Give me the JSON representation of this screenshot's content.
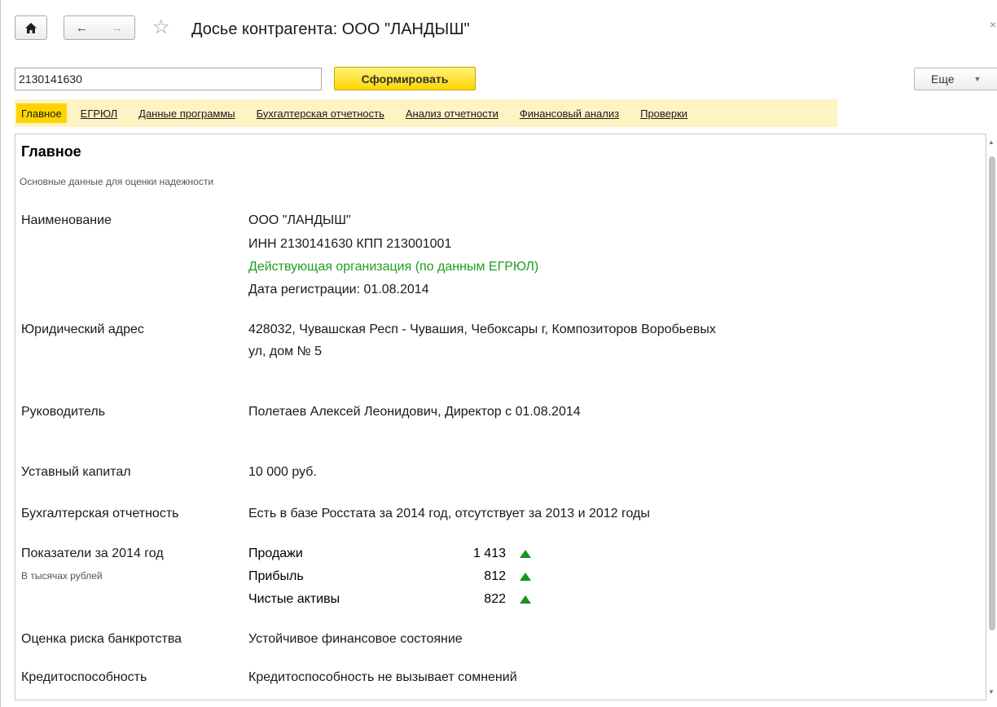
{
  "window": {
    "title": "Досье контрагента: ООО \"ЛАНДЫШ\""
  },
  "toolbar": {
    "inn_value": "2130141630",
    "generate_label": "Сформировать",
    "more_label": "Еще"
  },
  "tabs": [
    {
      "label": "Главное",
      "active": true
    },
    {
      "label": "ЕГРЮЛ"
    },
    {
      "label": "Данные программы"
    },
    {
      "label": "Бухгалтерская отчетность"
    },
    {
      "label": "Анализ отчетности"
    },
    {
      "label": "Финансовый анализ"
    },
    {
      "label": "Проверки"
    }
  ],
  "main": {
    "title": "Главное",
    "subtitle": "Основные данные для оценки надежности",
    "name": {
      "label": "Наименование",
      "company": "ООО \"ЛАНДЫШ\"",
      "inn_kpp": "ИНН 2130141630 КПП 213001001",
      "status": "Действующая организация (по данным ЕГРЮЛ)",
      "reg_date": "Дата регистрации: 01.08.2014"
    },
    "address": {
      "label": "Юридический адрес",
      "line1": "428032, Чувашская Респ - Чувашия, Чебоксары г, Композиторов Воробьевых",
      "line2": "ул, дом № 5"
    },
    "head": {
      "label": "Руководитель",
      "value": "Полетаев Алексей Леонидович, Директор с 01.08.2014"
    },
    "capital": {
      "label": "Уставный капитал",
      "value": "10 000 руб."
    },
    "reporting": {
      "label": "Бухгалтерская отчетность",
      "value": "Есть в базе Росстата за 2014 год, отсутствует за 2013 и 2012 годы"
    },
    "indicators": {
      "label": "Показатели за 2014 год",
      "note": "В тысячах рублей",
      "items": [
        {
          "name": "Продажи",
          "value": "1 413",
          "trend": "up"
        },
        {
          "name": "Прибыль",
          "value": "812",
          "trend": "up"
        },
        {
          "name": "Чистые активы",
          "value": "822",
          "trend": "up"
        }
      ],
      "trend_color": "#18931c"
    },
    "bankruptcy": {
      "label": "Оценка риска банкротства",
      "value": "Устойчивое финансовое состояние"
    },
    "credit": {
      "label": "Кредитоспособность",
      "value": "Кредитоспособность не вызывает сомнений"
    }
  },
  "icons": {
    "home": "home-icon",
    "back": "arrow-left-icon",
    "forward": "arrow-right-icon",
    "favorite": "star-icon",
    "close": "close-icon",
    "more_caret": "chevron-down-icon",
    "trend_up": "triangle-up-icon"
  }
}
